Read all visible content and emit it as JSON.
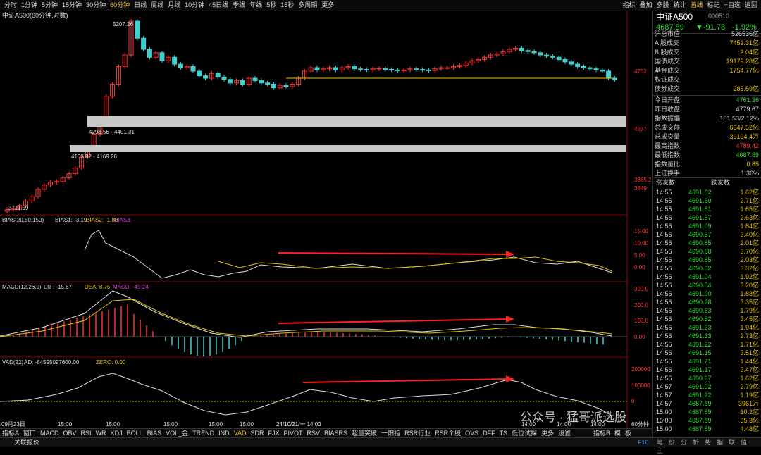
{
  "menu": {
    "left": [
      "分时",
      "1分钟",
      "5分钟",
      "15分钟",
      "30分钟",
      "60分钟",
      "日线",
      "周线",
      "月线",
      "10分钟",
      "45日线",
      "季线",
      "年线",
      "5秒",
      "15秒",
      "多周期",
      "更多"
    ],
    "active_index": 5,
    "right": [
      "指标",
      "叠加",
      "多股",
      "统计",
      "画线",
      "标记",
      "+自选",
      "返回"
    ]
  },
  "chart": {
    "title": "中证A500(60分钟,对数)",
    "high_label": "5207.26",
    "low_label": "3711.59",
    "zone1_label": "4298.56 - 4401.31",
    "zone2_label": "4103.82 - 4169.28",
    "price_axis": [
      "4752",
      "4277",
      "3885.2",
      "3849"
    ],
    "bias_header": {
      "name": "BIAS(20,50,150)",
      "b1": "BIAS1: -3.19",
      "b2": "BIAS2: -1.80",
      "b3": "BIAS3: -"
    },
    "bias_axis": [
      "15.00",
      "10.00",
      "5.00",
      "0.00"
    ],
    "macd_header": {
      "name": "MACD(12,26,9)",
      "dif": "DIF: -15.87",
      "dea": "DEA: 8.75",
      "macd": "MACD: -49.24"
    },
    "macd_axis": [
      "300.0",
      "200.0",
      "100.0",
      "0.00"
    ],
    "vad_header": {
      "name": "VAD(22)",
      "ad": "AD: -84595097600.00",
      "zero": "ZERO: 0.00"
    },
    "vad_axis": [
      "200000",
      "100000",
      "0"
    ],
    "time_axis": [
      "09月23日",
      "15:00",
      "15:00",
      "15:00",
      "15:00",
      "15:00",
      "24/10/21/一 14:00",
      "14:00",
      "14:00",
      "14:00",
      "14:00"
    ],
    "time_unit": "60分钟"
  },
  "bottom_tabs": [
    "指标A",
    "窗口",
    "MACD",
    "OBV",
    "RSI",
    "WR",
    "KDJ",
    "BOLL",
    "BIAS",
    "VOL_金",
    "TREND",
    "IND",
    "VAD",
    "SDR",
    "FJX",
    "PIVOT",
    "RSV",
    "BIASRS",
    "超量突破",
    "一阳指",
    "RSR行业",
    "RSR个股",
    "OVS",
    "DFF",
    "TS",
    "低位试探",
    "更多",
    "设置"
  ],
  "bottom_right": [
    "指标B",
    "模",
    "板"
  ],
  "status": {
    "left": "关联报价",
    "right": "F10"
  },
  "quote": {
    "name": "中证A500",
    "code": "000510",
    "price": "4687.89",
    "change": "▼-91.78",
    "pct": "-1.92%",
    "rows": [
      {
        "k": "沪总市值",
        "v": "526536亿",
        "c": "#ddd"
      },
      {
        "k": "A 股成交",
        "v": "7452.31亿",
        "c": "#e6c200"
      },
      {
        "k": "B 股成交",
        "v": "2.04亿",
        "c": "#e6c200"
      },
      {
        "k": "国债成交",
        "v": "19179.28亿",
        "c": "#e6c200"
      },
      {
        "k": "基金成交",
        "v": "1754.77亿",
        "c": "#e6c200"
      },
      {
        "k": "权证成交",
        "v": "",
        "c": "#e6c200"
      },
      {
        "k": "债券成交",
        "v": "285.59亿",
        "c": "#e6c200"
      }
    ],
    "rows2": [
      {
        "k": "今日开盘",
        "v": "4761.36",
        "c": "#33dd33"
      },
      {
        "k": "昨日收盘",
        "v": "4779.67",
        "c": "#ddd"
      },
      {
        "k": "指数振幅",
        "v": "101.53/2.12%",
        "c": "#ddd"
      },
      {
        "k": "总成交额",
        "v": "6647.52亿",
        "c": "#e6c200"
      },
      {
        "k": "总成交量",
        "v": "39194.4万",
        "c": "#e6c200"
      },
      {
        "k": "最高指数",
        "v": "4789.42",
        "c": "#ff3333"
      },
      {
        "k": "最低指数",
        "v": "4687.89",
        "c": "#33dd33"
      },
      {
        "k": "指数量比",
        "v": "0.85",
        "c": "#e6c200"
      },
      {
        "k": "上证换手",
        "v": "1.36%",
        "c": "#ddd"
      }
    ],
    "tick_header": [
      "涨家数",
      "跌家数"
    ],
    "ticks": [
      [
        "14:55",
        "4691.62",
        "1.62亿"
      ],
      [
        "14:55",
        "4691.60",
        "2.71亿"
      ],
      [
        "14:55",
        "4691.51",
        "1.65亿"
      ],
      [
        "14:56",
        "4691.67",
        "2.63亿"
      ],
      [
        "14:56",
        "4691.09",
        "1.84亿"
      ],
      [
        "14:56",
        "4690.57",
        "3.40亿"
      ],
      [
        "14:56",
        "4690.85",
        "2.01亿"
      ],
      [
        "14:56",
        "4690.88",
        "3.70亿"
      ],
      [
        "14:56",
        "4690.85",
        "2.03亿"
      ],
      [
        "14:56",
        "4690.52",
        "3.32亿"
      ],
      [
        "14:56",
        "4691.04",
        "1.92亿"
      ],
      [
        "14:56",
        "4690.54",
        "3.20亿"
      ],
      [
        "14:56",
        "4691.00",
        "1.88亿"
      ],
      [
        "14:56",
        "4690.98",
        "3.35亿"
      ],
      [
        "14:56",
        "4690.63",
        "1.79亿"
      ],
      [
        "14:56",
        "4690.82",
        "3.45亿"
      ],
      [
        "14:56",
        "4691.33",
        "1.94亿"
      ],
      [
        "14:56",
        "4691.33",
        "2.73亿"
      ],
      [
        "14:56",
        "4691.22",
        "1.71亿"
      ],
      [
        "14:56",
        "4691.15",
        "3.51亿"
      ],
      [
        "14:56",
        "4691.71",
        "1.44亿"
      ],
      [
        "14:56",
        "4691.17",
        "3.47亿"
      ],
      [
        "14:56",
        "4690.97",
        "1.62亿"
      ],
      [
        "14:57",
        "4691.02",
        "2.79亿"
      ],
      [
        "14:57",
        "4691.22",
        "1.19亿"
      ],
      [
        "14:57",
        "4687.89",
        "3961万"
      ],
      [
        "15:00",
        "4687.89",
        "10.2亿"
      ],
      [
        "15:00",
        "4687.89",
        "65.3亿"
      ],
      [
        "15:00",
        "4687.89",
        "4.48亿"
      ]
    ],
    "tick_footer": [
      "笔",
      "价",
      "分",
      "析",
      "势",
      "指",
      "联",
      "值",
      "主"
    ]
  },
  "watermark": "公众号 · 猛哥派选股"
}
